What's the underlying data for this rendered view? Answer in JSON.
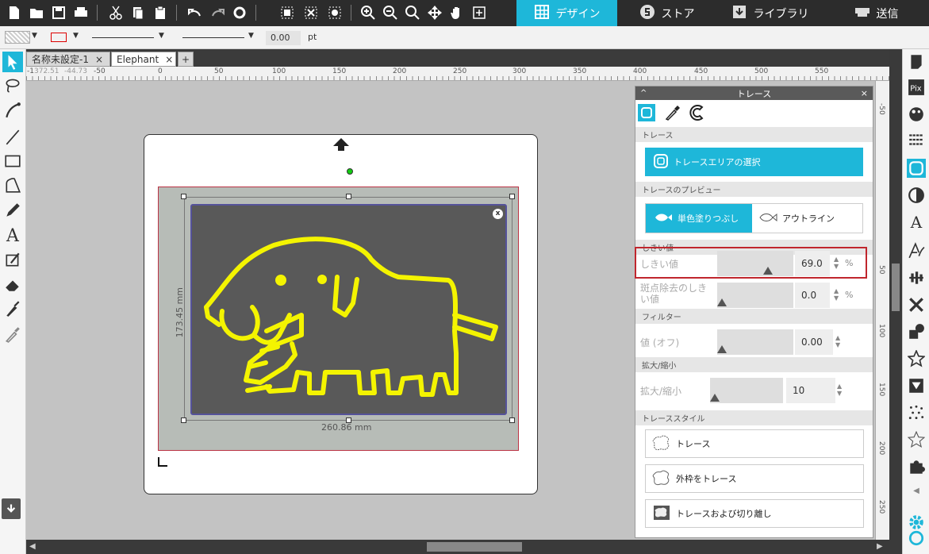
{
  "nav_tabs": [
    {
      "label": "デザイン",
      "icon": "grid-icon",
      "active": true
    },
    {
      "label": "ストア",
      "icon": "s-logo-icon",
      "active": false
    },
    {
      "label": "ライブラリ",
      "icon": "download-icon",
      "active": false
    },
    {
      "label": "送信",
      "icon": "cutter-icon",
      "active": false
    }
  ],
  "line_toolbar": {
    "width_value": "0.00",
    "unit": "pt"
  },
  "doc_tabs": [
    {
      "label": "名称未設定-1",
      "close": "×"
    },
    {
      "label": "Elephant",
      "close": "×"
    }
  ],
  "add_tab": "+",
  "ruler": {
    "coords": [
      "-1",
      "372.51",
      "-44.73"
    ],
    "labels": [
      "-50",
      "0",
      "50",
      "100",
      "150",
      "200",
      "250",
      "300",
      "350",
      "400",
      "450",
      "500",
      "550"
    ]
  },
  "vruler_labels": [
    "-50",
    "50",
    "100",
    "150",
    "200",
    "250"
  ],
  "canvas": {
    "height_dim": "173.45 mm",
    "width_dim": "260.86 mm",
    "close_x": "x"
  },
  "panel": {
    "title": "トレース",
    "close": "×",
    "sections": {
      "trace": "トレース",
      "preview": "トレースのプレビュー",
      "threshold": "しきい値",
      "filter": "フィルター",
      "scale": "拡大/縮小",
      "style": "トレーススタイル"
    },
    "select_area_button": "トレースエリアの選択",
    "preview_fill": "単色塗りつぶし",
    "preview_outline": "アウトライン",
    "threshold": {
      "label": "しきい値",
      "value": "69.0",
      "unit": "%",
      "level": 0.69
    },
    "despeckle": {
      "label": "斑点除去のしきい値",
      "value": "0.0",
      "unit": "%",
      "level": 0.0
    },
    "filter_value": {
      "label": "値 (オフ)",
      "value": "0.00",
      "level": 0.0
    },
    "scale_value": {
      "label": "拡大/縮小",
      "value": "10",
      "level": 0.0
    },
    "style_buttons": [
      "トレース",
      "外枠をトレース",
      "トレースおよび切り離し"
    ]
  },
  "colors": {
    "accent": "#1eb7d9",
    "highlight_border": "#c0262d",
    "trace_yellow": "#f4f400"
  }
}
